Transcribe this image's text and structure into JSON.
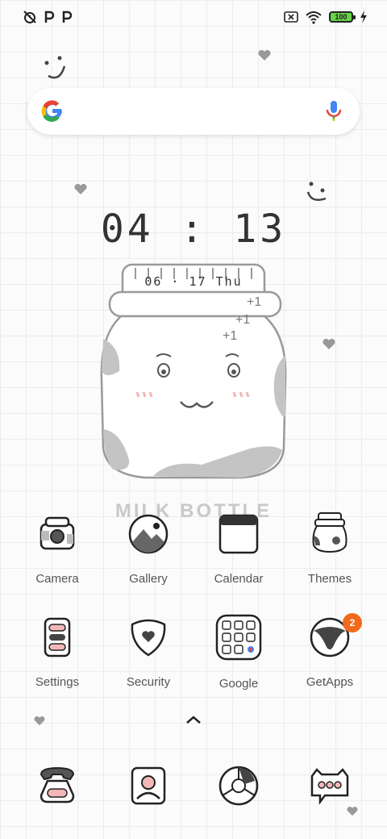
{
  "status_bar": {
    "left_icons": [
      "alarm-off-icon",
      "parking-app-icon",
      "parking-app-icon"
    ],
    "battery_level": "100",
    "right_icons": [
      "sim-off-icon",
      "wifi-icon",
      "battery-icon",
      "charging-icon"
    ]
  },
  "clock": {
    "time": "04 : 13",
    "date": "06 · 17  Thu"
  },
  "wallpaper": {
    "label": "MILK BOTTLE",
    "plus_marks": [
      "+1",
      "+1",
      "+1"
    ]
  },
  "apps": [
    {
      "label": "Camera",
      "icon": "camera-icon"
    },
    {
      "label": "Gallery",
      "icon": "gallery-icon"
    },
    {
      "label": "Calendar",
      "icon": "calendar-icon"
    },
    {
      "label": "Themes",
      "icon": "themes-icon"
    },
    {
      "label": "Settings",
      "icon": "settings-icon"
    },
    {
      "label": "Security",
      "icon": "security-icon"
    },
    {
      "label": "Google",
      "icon": "google-folder-icon"
    },
    {
      "label": "GetApps",
      "icon": "getapps-icon",
      "badge": "2"
    }
  ],
  "dock": [
    {
      "icon": "phone-icon"
    },
    {
      "icon": "contacts-icon"
    },
    {
      "icon": "browser-icon"
    },
    {
      "icon": "messages-icon"
    }
  ],
  "colors": {
    "badge": "#f26a1b",
    "battery": "#67d34a",
    "grid": "#ececec"
  }
}
